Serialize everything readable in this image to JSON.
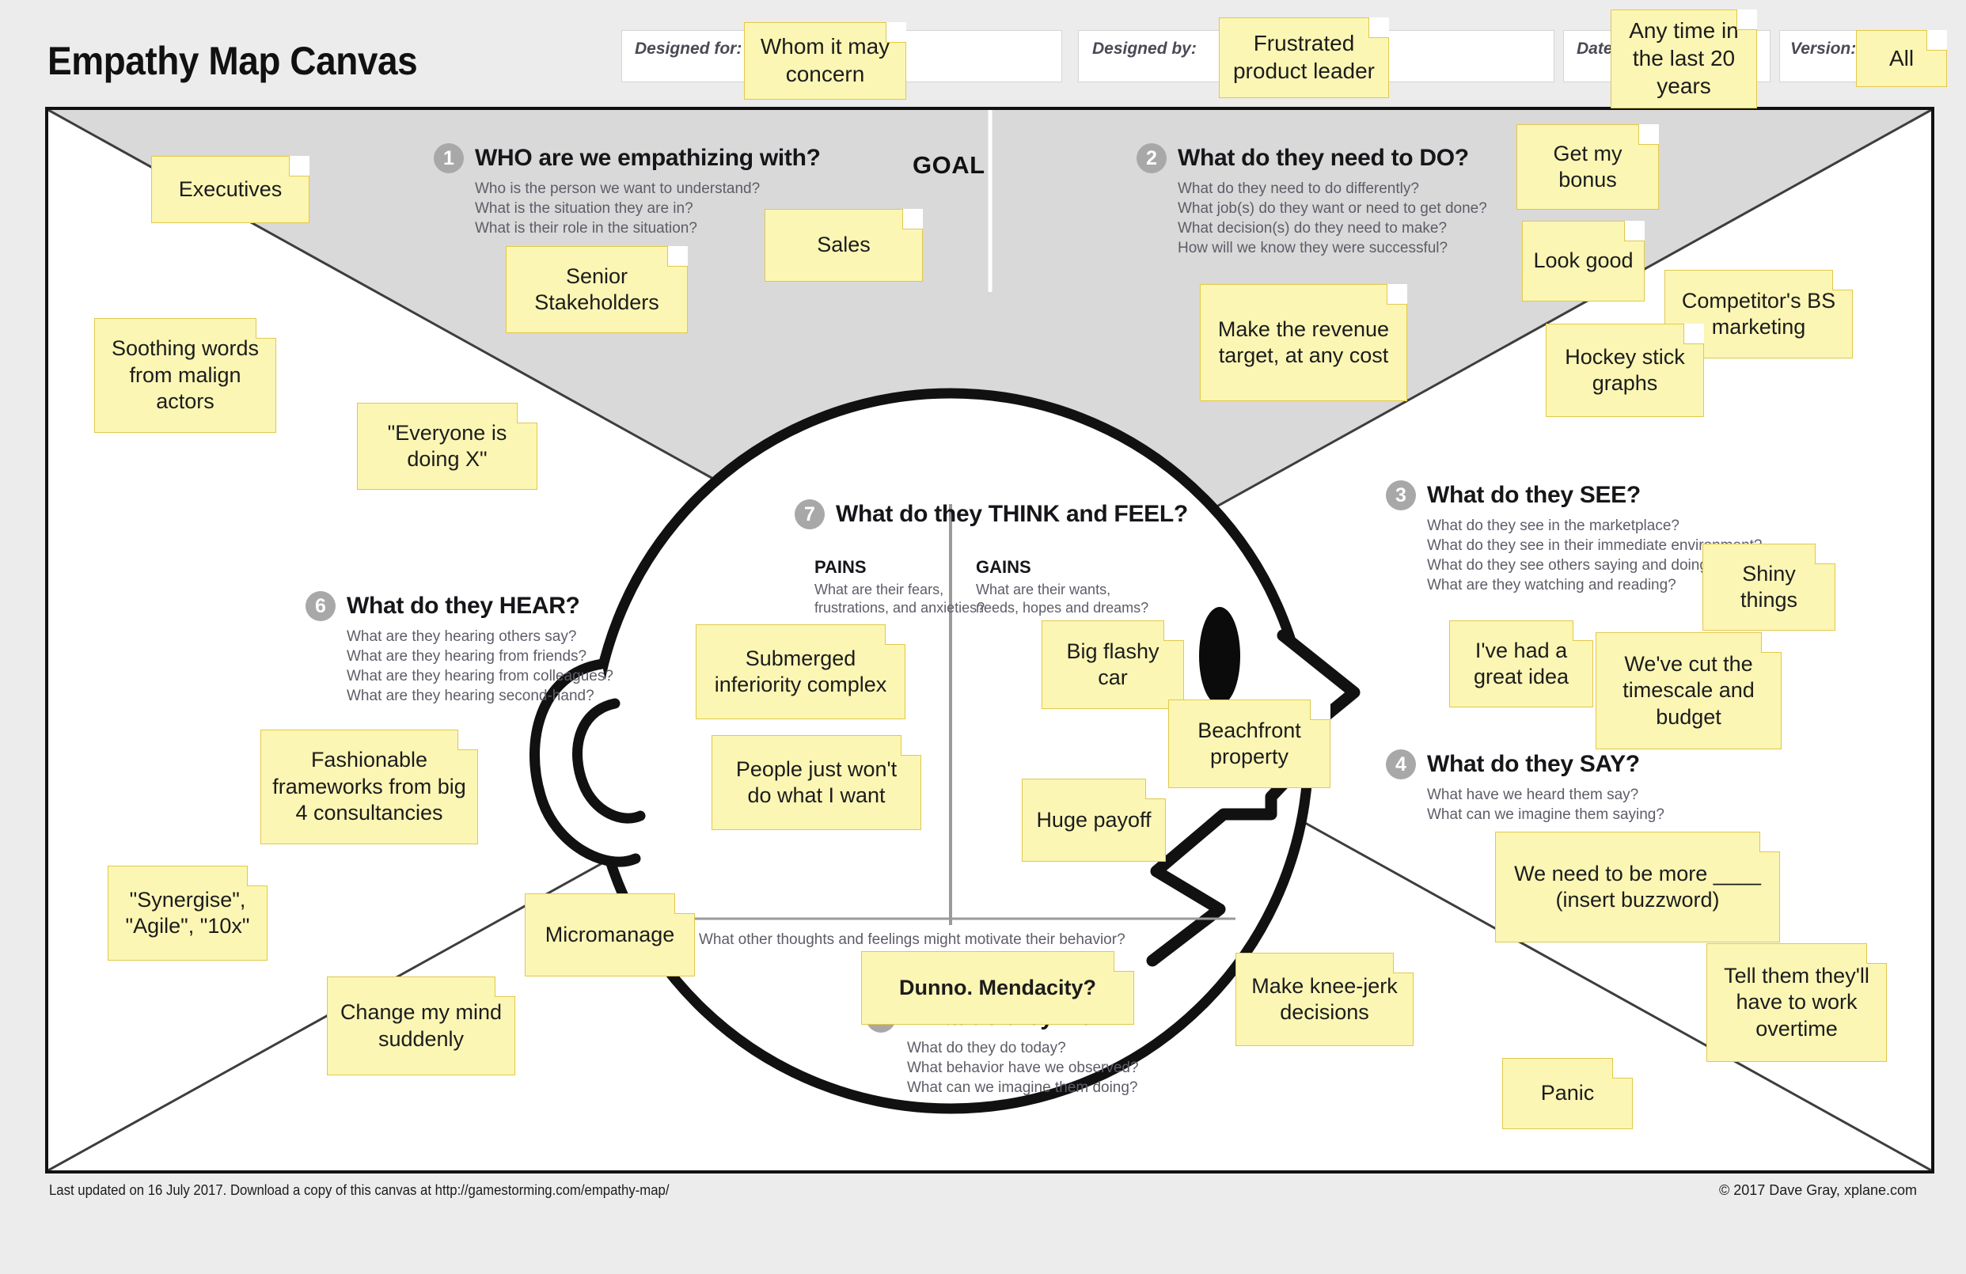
{
  "title": "Empathy Map Canvas",
  "header": {
    "fields": [
      {
        "label": "Designed for:",
        "note": "Whom it may concern"
      },
      {
        "label": "Designed by:",
        "note": "Frustrated product leader"
      },
      {
        "label": "Date:",
        "note": "Any time in the last 20 years"
      },
      {
        "label": "Version:",
        "note": "All"
      }
    ]
  },
  "goal_label": "GOAL",
  "sections": {
    "who": {
      "number": "1",
      "title": "WHO are we empathizing with?",
      "questions": [
        "Who is the person we want to understand?",
        "What is the situation they are in?",
        "What is their role in the situation?"
      ]
    },
    "do_need": {
      "number": "2",
      "title": "What do they need to DO?",
      "questions": [
        "What do they need to do differently?",
        "What job(s) do they want or need to get done?",
        "What decision(s) do they need to make?",
        "How will we know they were successful?"
      ]
    },
    "see": {
      "number": "3",
      "title": "What do they SEE?",
      "questions": [
        "What do they see in the marketplace?",
        "What do they see in their immediate environment?",
        "What do they see others saying and doing?",
        "What are they watching and reading?"
      ]
    },
    "say": {
      "number": "4",
      "title": "What do they SAY?",
      "questions": [
        "What have we heard them say?",
        "What can we imagine them saying?"
      ]
    },
    "do": {
      "number": "5",
      "title": "What do they DO?",
      "questions": [
        "What do they do today?",
        "What behavior have we observed?",
        "What can we imagine them doing?"
      ]
    },
    "hear": {
      "number": "6",
      "title": "What do they HEAR?",
      "questions": [
        "What are they hearing others say?",
        "What are they hearing from friends?",
        "What are they hearing from colleagues?",
        "What are they hearing second-hand?"
      ]
    },
    "think_feel": {
      "number": "7",
      "title": "What do they THINK and FEEL?",
      "pains_title": "PAINS",
      "pains_sub": [
        "What are their fears,",
        "frustrations, and anxieties?"
      ],
      "gains_title": "GAINS",
      "gains_sub": [
        "What are their wants,",
        "needs, hopes and dreams?"
      ],
      "footer": "What other thoughts and feelings might motivate their behavior?"
    }
  },
  "notes": [
    {
      "id": "n-executives",
      "text": "Executives"
    },
    {
      "id": "n-sales",
      "text": "Sales"
    },
    {
      "id": "n-senior-stakeholders",
      "text": "Senior Stakeholders"
    },
    {
      "id": "n-soothing-words",
      "text": "Soothing words from malign actors"
    },
    {
      "id": "n-everyone-doing-x",
      "text": "\"Everyone is doing X\""
    },
    {
      "id": "n-fashionable-frameworks",
      "text": "Fashionable frameworks from big 4 consultancies"
    },
    {
      "id": "n-synergise",
      "text": "\"Synergise\", \"Agile\", \"10x\""
    },
    {
      "id": "n-change-my-mind",
      "text": "Change my mind suddenly"
    },
    {
      "id": "n-micromanage",
      "text": "Micromanage"
    },
    {
      "id": "n-submerged-inferiority",
      "text": "Submerged inferiority complex"
    },
    {
      "id": "n-people-wont-do",
      "text": "People just won't do what I want"
    },
    {
      "id": "n-big-flashy-car",
      "text": "Big flashy car"
    },
    {
      "id": "n-beachfront-property",
      "text": "Beachfront property"
    },
    {
      "id": "n-huge-payoff",
      "text": "Huge payoff"
    },
    {
      "id": "n-dunno-mendacity",
      "text": "Dunno. Mendacity?"
    },
    {
      "id": "n-make-revenue-target",
      "text": "Make the revenue target, at any cost"
    },
    {
      "id": "n-get-my-bonus",
      "text": "Get my bonus"
    },
    {
      "id": "n-look-good",
      "text": "Look good"
    },
    {
      "id": "n-competitors-bs",
      "text": "Competitor's BS marketing"
    },
    {
      "id": "n-hockey-stick",
      "text": "Hockey stick graphs"
    },
    {
      "id": "n-shiny-things",
      "text": "Shiny things"
    },
    {
      "id": "n-great-idea",
      "text": "I've had a great idea"
    },
    {
      "id": "n-cut-timescale",
      "text": "We've cut the timescale and budget"
    },
    {
      "id": "n-insert-buzzword",
      "text": "We need to be more ____ (insert buzzword)"
    },
    {
      "id": "n-work-overtime",
      "text": "Tell them they'll have to work overtime"
    },
    {
      "id": "n-knee-jerk",
      "text": "Make knee-jerk decisions"
    },
    {
      "id": "n-panic",
      "text": "Panic"
    }
  ],
  "footer": {
    "left": "Last updated on 16 July 2017. Download a copy of this canvas at http://gamestorming.com/empathy-map/",
    "right": "© 2017 Dave Gray, xplane.com"
  },
  "colors": {
    "note_fill": "#fbf6b4",
    "note_border": "#e2c84a",
    "wedge_gray": "#d9d9d9",
    "page_bg": "#ececec",
    "number_badge": "#a8a8a8"
  }
}
